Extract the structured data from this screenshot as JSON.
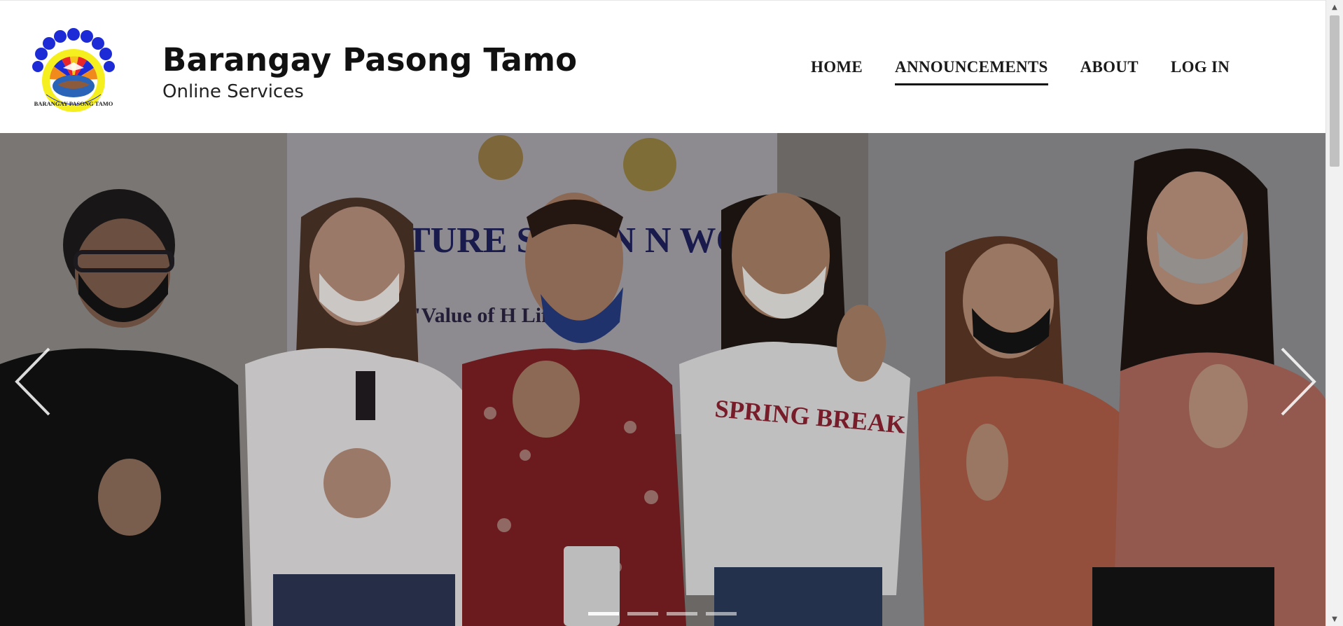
{
  "header": {
    "title": "Barangay Pasong Tamo",
    "subtitle": "Online Services",
    "logo_icon": "barangay-seal-logo"
  },
  "nav": {
    "items": [
      {
        "label": "HOME",
        "active": false
      },
      {
        "label": "ANNOUNCEMENTS",
        "active": true
      },
      {
        "label": "ABOUT",
        "active": false
      },
      {
        "label": "LOG IN",
        "active": false
      }
    ]
  },
  "carousel": {
    "prev_icon": "chevron-left-icon",
    "next_icon": "chevron-right-icon",
    "slide_count": 4,
    "active_slide": 1,
    "banner_line1": "TURE SEMIN   N WOMI",
    "banner_line2": "\"Value of H     Lifestyle\"",
    "shirt_text": "SPRING BREAK"
  },
  "colors": {
    "header_bg": "#ffffff",
    "nav_text": "#1a1a1a",
    "logo_blue": "#1c2bd6",
    "logo_yellow": "#f5ef1f"
  }
}
